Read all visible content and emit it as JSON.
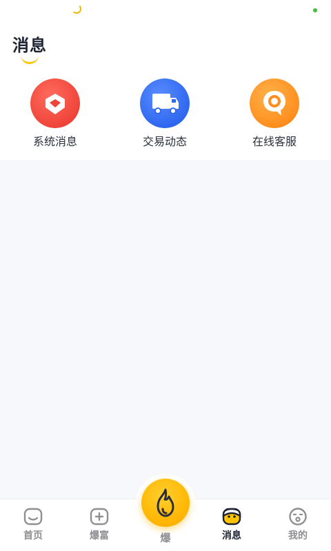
{
  "header": {
    "title": "消息"
  },
  "shortcuts": [
    {
      "label": "系统消息",
      "icon": "system-message-icon",
      "color": "#f0443a"
    },
    {
      "label": "交易动态",
      "icon": "truck-icon",
      "color": "#2f68f0"
    },
    {
      "label": "在线客服",
      "icon": "chat-bubble-icon",
      "color": "#ff8e1e"
    }
  ],
  "tabbar": {
    "tabs": [
      {
        "label": "首页",
        "icon": "home-face-icon",
        "active": false
      },
      {
        "label": "爆富",
        "icon": "plus-square-icon",
        "active": false
      },
      {
        "label": "爆",
        "icon": "flame-icon",
        "active": false
      },
      {
        "label": "消息",
        "icon": "chat-face-icon",
        "active": true
      },
      {
        "label": "我的",
        "icon": "profile-face-icon",
        "active": false
      }
    ]
  },
  "colors": {
    "accent": "#ffc400",
    "background": "#f7f8fc"
  }
}
